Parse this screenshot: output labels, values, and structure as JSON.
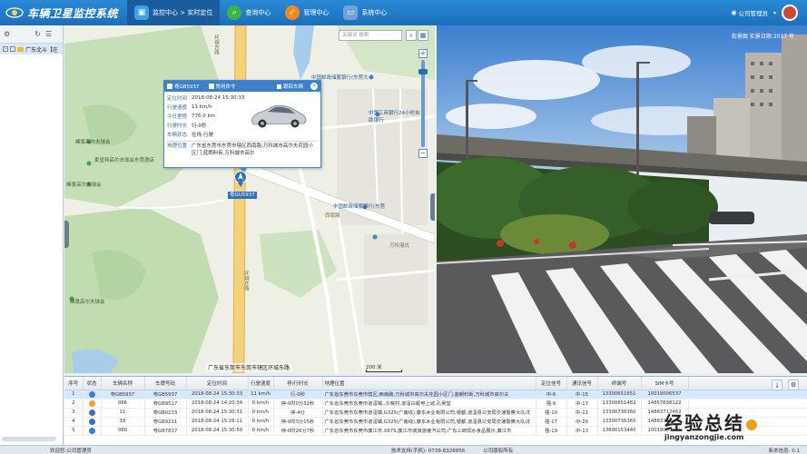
{
  "app": {
    "title": "车辆卫星监控系统"
  },
  "nav": [
    {
      "label": "监控中心 > 实时定位",
      "icon": "monitor-icon",
      "active": true
    },
    {
      "label": "查询中心",
      "icon": "search-icon",
      "active": false
    },
    {
      "label": "管理中心",
      "icon": "gear-icon",
      "active": false
    },
    {
      "label": "系统中心",
      "icon": "computer-icon",
      "active": false
    }
  ],
  "user": {
    "label": "公司管理员"
  },
  "left_panel": {
    "tree_root": "广东北斗【在"
  },
  "map": {
    "search_placeholder": "关键词 搜索",
    "labels": {
      "road1": "环城东路",
      "poi1": "中国邮政储蓄银行(东莞大",
      "poi2": "中国工商银行24小时自助银行",
      "poi3": "峰景高尔夫球会",
      "poi4": "麦显特高尔夫球会东莞酒店",
      "poi5": "峰景高尔夫球会",
      "road2": "西南路",
      "poi6": "中国邮政储蓄银行(东莞",
      "road3": "万科港式",
      "poi7": "峰景高尔夫球会",
      "road4": "环城东路"
    },
    "address_bar": "广东省东莞市东莞市辖区环城东路",
    "scale_label": "200 米",
    "plate_tag": "粤GU5937"
  },
  "popup": {
    "tab1": "粤GB5937",
    "tab2": "常用命令",
    "follow_label": "跟踪车辆",
    "rows": [
      {
        "label": "定位时间",
        "value": "2018-08-24 15:30:33"
      },
      {
        "label": "行驶速度",
        "value": "11 km/h"
      },
      {
        "label": "今日里程",
        "value": "776.0 km"
      },
      {
        "label": "行驶时长",
        "value": "行-0秒"
      },
      {
        "label": "车辆状态",
        "value": "在线-行驶"
      }
    ],
    "address_label": "地理位置",
    "address_value": "广东省东莞市东莞市辖区西南路;万科城市高尔夫花园小区门,蓝朗料街,万科城市高尔"
  },
  "streetview": {
    "title": "街景图 实景日期:2017 年"
  },
  "table": {
    "headers": [
      "序号",
      "状态",
      "车辆名称",
      "车牌号码",
      "定位时间",
      "行驶速度",
      "停/行时长",
      "地理位置",
      "定位信号",
      "通讯信号",
      "终端号",
      "SIM卡号"
    ],
    "rows": [
      {
        "no": "1",
        "status_color": "#3b7dd8",
        "name": "粤GB5937",
        "plate": "粤GB5937",
        "time": "2018-08-24 15:30:33",
        "speed": "11 km/h",
        "duration": "行-0秒",
        "location": "广东省东莞市东莞市辖区;西南路;万科城市高尔夫花园小区门,蓝朗料街,万科城市高尔夫",
        "gps": "中-6",
        "comm": "中-15",
        "terminal": "13300651651",
        "sim": "10019006537",
        "selected": true
      },
      {
        "no": "2",
        "status_color": "#e6a23c",
        "name": "086",
        "plate": "粤GB9517",
        "time": "2018-08-24 14:20:34",
        "speed": "0 km/h",
        "duration": "停-0时0分32秒",
        "location": "广东省东莞市东莞市道滘镇,,沙窝村,道滘白蚬电上城,孔吴堂",
        "gps": "强-9",
        "comm": "中-17",
        "terminal": "13300651482",
        "sim": "14857698122",
        "selected": false
      },
      {
        "no": "3",
        "status_color": "#3f6fa8",
        "name": "11",
        "plate": "粤GB0233",
        "time": "2018-08-24 15:30:31",
        "speed": "0 km/h",
        "duration": "停-4分",
        "location": "广东省东莞市东莞市道滘镇,G325(广南线),康东木业有限公司,银都,道滘县公安局交通警察大队详",
        "gps": "强-10",
        "comm": "中-11",
        "terminal": "13300736360",
        "sim": "14863712462",
        "selected": false
      },
      {
        "no": "4",
        "status_color": "#3f6fa8",
        "name": "18",
        "plate": "粤GB9211",
        "time": "2018-08-24 15:26:11",
        "speed": "0 km/h",
        "duration": "停-0时3分15秒",
        "location": "广东省东莞市东莞市道滘镇,G325(广南线),康东木业有限公司,银都,道滘县公安局交通警察大队详",
        "gps": "强-17",
        "comm": "中-20",
        "terminal": "13300736365",
        "sim": "14863712464",
        "selected": false
      },
      {
        "no": "5",
        "status_color": "#3b7dd8",
        "name": "080",
        "plate": "粤GB7837",
        "time": "2018-08-24 15:30:50",
        "speed": "0 km/h",
        "duration": "停-0时26分7秒",
        "location": "广东省东莞市东莞市廉江市,X675,廉江市城旅游度汽公司,广东三郎饲水食品展示,廉江市",
        "gps": "强-19",
        "comm": "中-13",
        "terminal": "13600153440",
        "sim": "10019000631",
        "selected": false
      }
    ]
  },
  "footer": {
    "left": "欢迎您:公司管理员",
    "mid": "技术支持(手机): 0739-8328856",
    "mid2": "公司版权所有",
    "right": "新本信息: 0.1"
  },
  "watermark": {
    "big": "经验总结",
    "small": "jingyanzongjie.com"
  }
}
